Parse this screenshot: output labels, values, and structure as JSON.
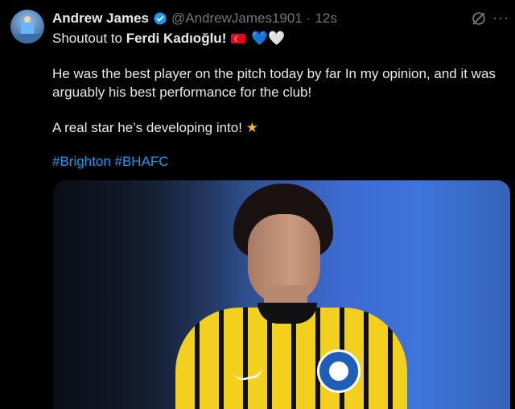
{
  "tweet": {
    "author_name": "Andrew James",
    "author_handle": "@AndrewJames1901",
    "separator": "·",
    "time": "12s",
    "intro": "Shoutout to ",
    "mention_name": "Ferdi Kadıoğlu!",
    "heart_blue": "💙",
    "heart_white": "🤍",
    "body_line1": "He was the best player on the pitch today by far In my opinion, and it was",
    "body_line2": "arguably his best performance for the club!",
    "body_line3": "A real star he’s developing into!",
    "star": "★",
    "hashtags": [
      "#Brighton",
      "#BHAFC"
    ],
    "more_label": "···"
  },
  "colors": {
    "background": "#000000",
    "text": "#e7e9ea",
    "muted": "#71767b",
    "link": "#1d9bf0",
    "verified": "#1d9bf0"
  },
  "icons": {
    "verified": "verified-badge-icon",
    "grok": "grok-icon",
    "more": "more-icon",
    "flag": "turkey-flag-icon"
  }
}
